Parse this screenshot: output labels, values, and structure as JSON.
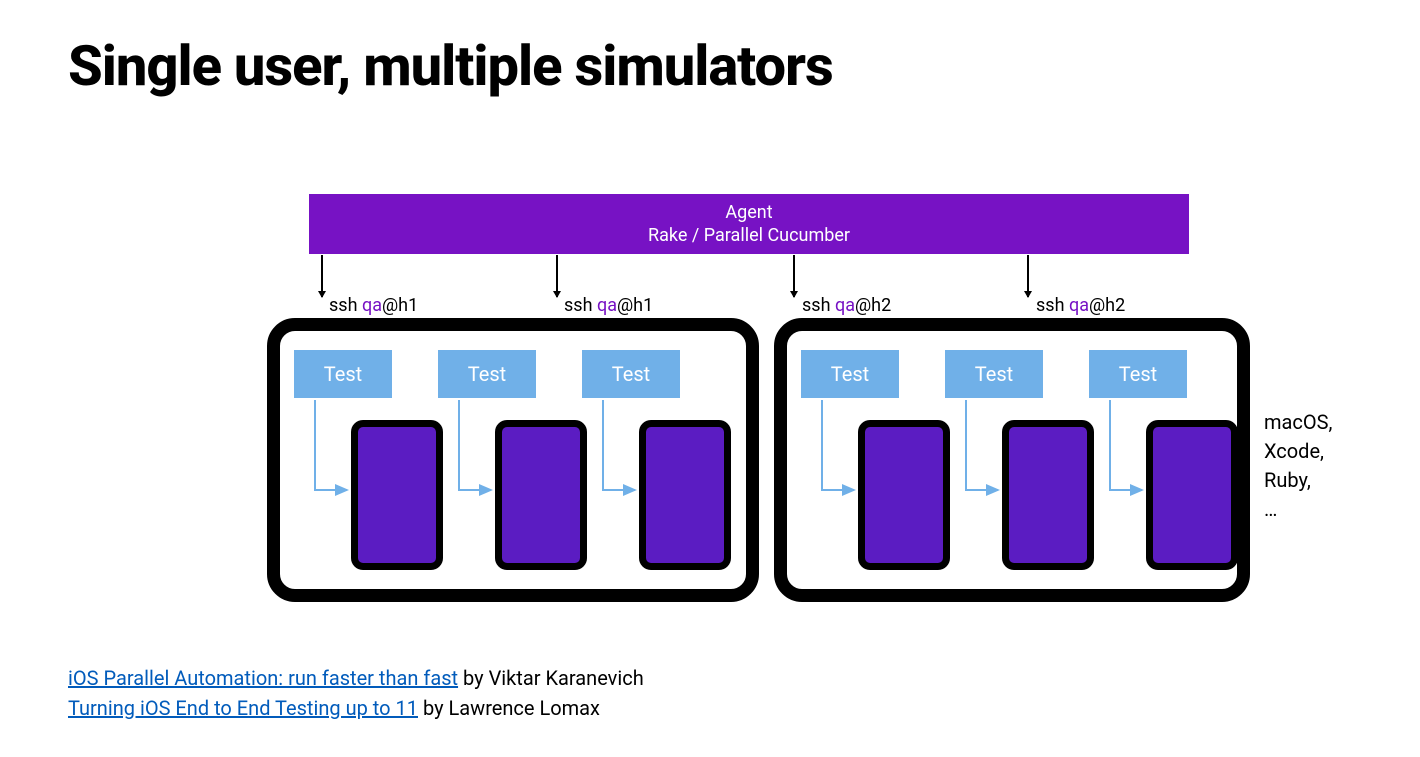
{
  "title": "Single user, multiple simulators",
  "agent": {
    "line1": "Agent",
    "line2": "Rake / Parallel Cucumber"
  },
  "ssh": [
    {
      "prefix": "ssh  ",
      "user": "qa",
      "rest": "@h1"
    },
    {
      "prefix": "ssh ",
      "user": "qa",
      "rest": "@h1"
    },
    {
      "prefix": "ssh ",
      "user": "qa",
      "rest": "@h2"
    },
    {
      "prefix": "ssh ",
      "user": "qa",
      "rest": "@h2"
    }
  ],
  "test_label": "Test",
  "env": {
    "l1": "macOS,",
    "l2": "Xcode,",
    "l3": "Ruby,",
    "l4": "…"
  },
  "refs": {
    "r1_link": "iOS Parallel Automation: run faster than fast",
    "r1_by": " by Viktar Karanevich",
    "r2_link": "Turning iOS End to End Testing up to 11",
    "r2_by": " by Lawrence Lomax"
  }
}
